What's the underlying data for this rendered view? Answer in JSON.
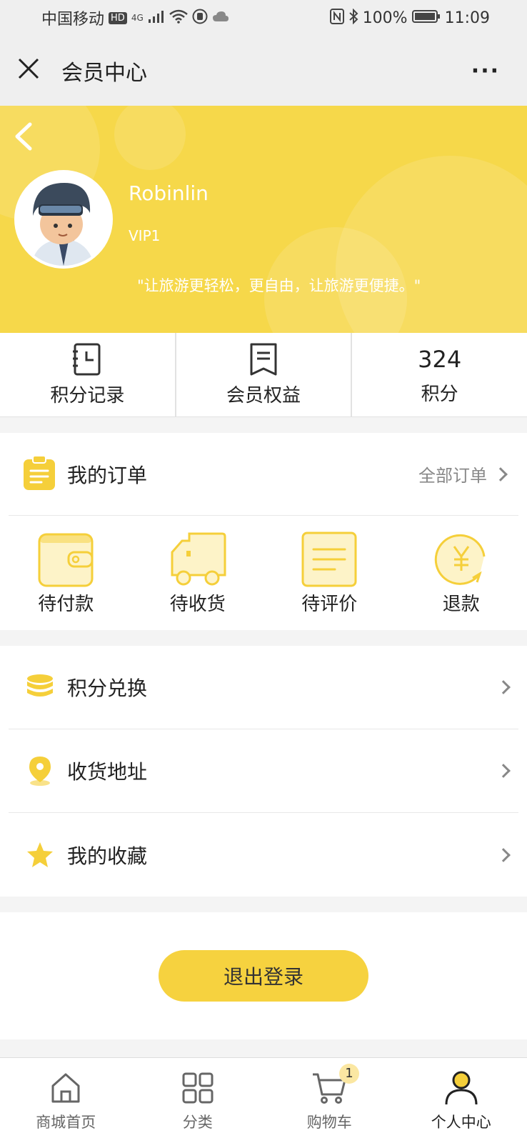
{
  "status_bar": {
    "carrier": "中国移动",
    "hd": "HD",
    "network": "4G",
    "battery": "100%",
    "time": "11:09"
  },
  "nav": {
    "title": "会员中心",
    "more": "···"
  },
  "profile": {
    "username": "Robinlin",
    "level": "VIP1",
    "slogan": "\"让旅游更轻松，更自由，让旅游更便捷。\""
  },
  "stats": {
    "points_record": "积分记录",
    "member_benefits": "会员权益",
    "points_value": "324",
    "points_label": "积分"
  },
  "orders": {
    "title": "我的订单",
    "all_label": "全部订单",
    "items": [
      {
        "label": "待付款",
        "icon": "wallet-icon"
      },
      {
        "label": "待收货",
        "icon": "truck-icon"
      },
      {
        "label": "待评价",
        "icon": "review-icon"
      },
      {
        "label": "退款",
        "icon": "refund-icon"
      }
    ]
  },
  "menu": [
    {
      "label": "积分兑换",
      "icon": "coins-icon"
    },
    {
      "label": "收货地址",
      "icon": "location-pin-icon"
    },
    {
      "label": "我的收藏",
      "icon": "star-icon"
    }
  ],
  "logout_label": "退出登录",
  "tabs": [
    {
      "label": "商城首页",
      "icon": "home-icon"
    },
    {
      "label": "分类",
      "icon": "grid-icon"
    },
    {
      "label": "购物车",
      "icon": "cart-icon",
      "badge": "1"
    },
    {
      "label": "个人中心",
      "icon": "user-icon",
      "active": true
    }
  ],
  "colors": {
    "accent": "#f6d84a",
    "button": "#f6d23f",
    "icon_yellow": "#f5cf3a"
  }
}
